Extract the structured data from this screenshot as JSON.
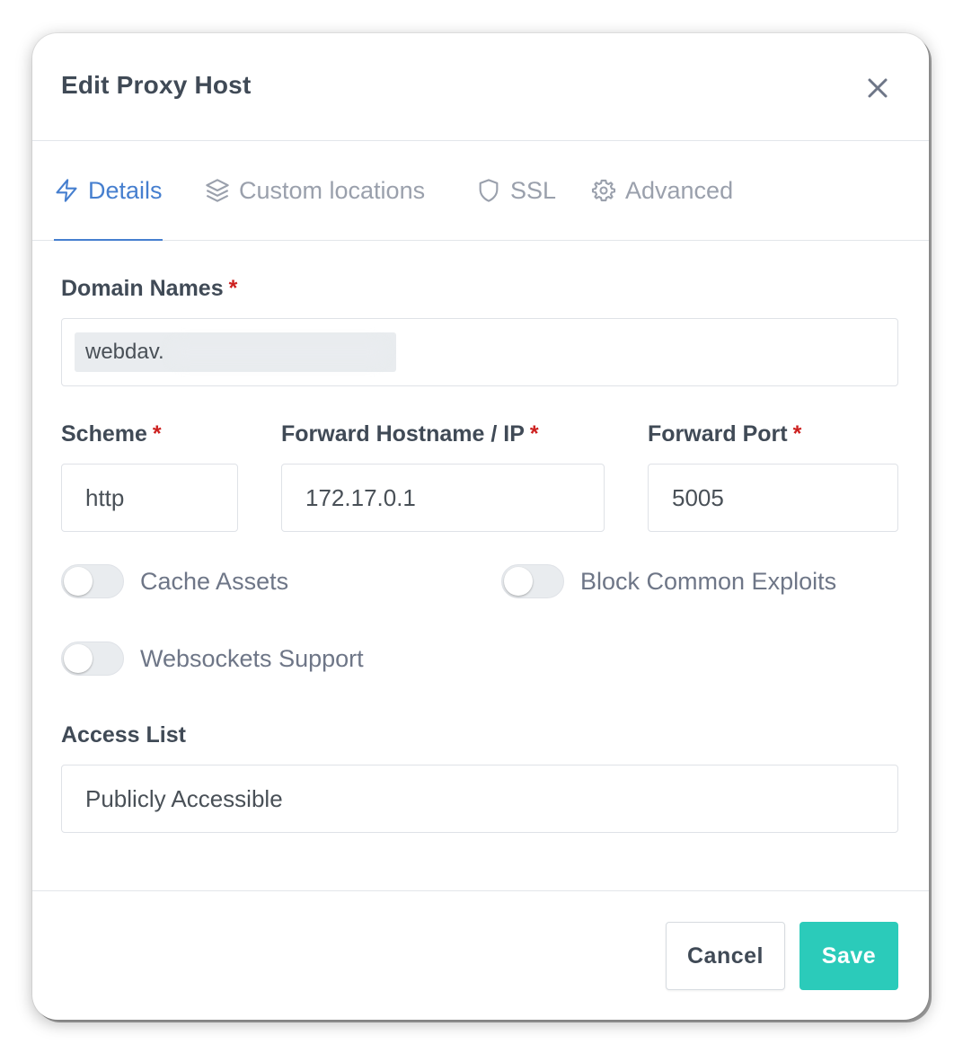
{
  "modal": {
    "title": "Edit Proxy Host"
  },
  "tabs": [
    {
      "label": "Details",
      "icon": "lightning-icon",
      "active": true
    },
    {
      "label": "Custom locations",
      "icon": "layers-icon",
      "active": false
    },
    {
      "label": "SSL",
      "icon": "shield-icon",
      "active": false
    },
    {
      "label": "Advanced",
      "icon": "gear-icon",
      "active": false
    }
  ],
  "form": {
    "domain_names": {
      "label": "Domain Names",
      "required_mark": "*",
      "chip": "webdav."
    },
    "scheme": {
      "label": "Scheme",
      "required_mark": "*",
      "value": "http"
    },
    "forward_host": {
      "label": "Forward Hostname / IP",
      "required_mark": "*",
      "value": "172.17.0.1"
    },
    "forward_port": {
      "label": "Forward Port",
      "required_mark": "*",
      "value": "5005"
    },
    "toggles": {
      "cache_assets": {
        "label": "Cache Assets",
        "on": false
      },
      "block_exploits": {
        "label": "Block Common Exploits",
        "on": false
      },
      "websockets": {
        "label": "Websockets Support",
        "on": false
      }
    },
    "access_list": {
      "label": "Access List",
      "value": "Publicly Accessible"
    }
  },
  "footer": {
    "cancel_label": "Cancel",
    "save_label": "Save"
  },
  "colors": {
    "accent": "#467fcf",
    "save": "#2bcbba",
    "required": "#cd201f",
    "muted": "#9aa0ac"
  }
}
